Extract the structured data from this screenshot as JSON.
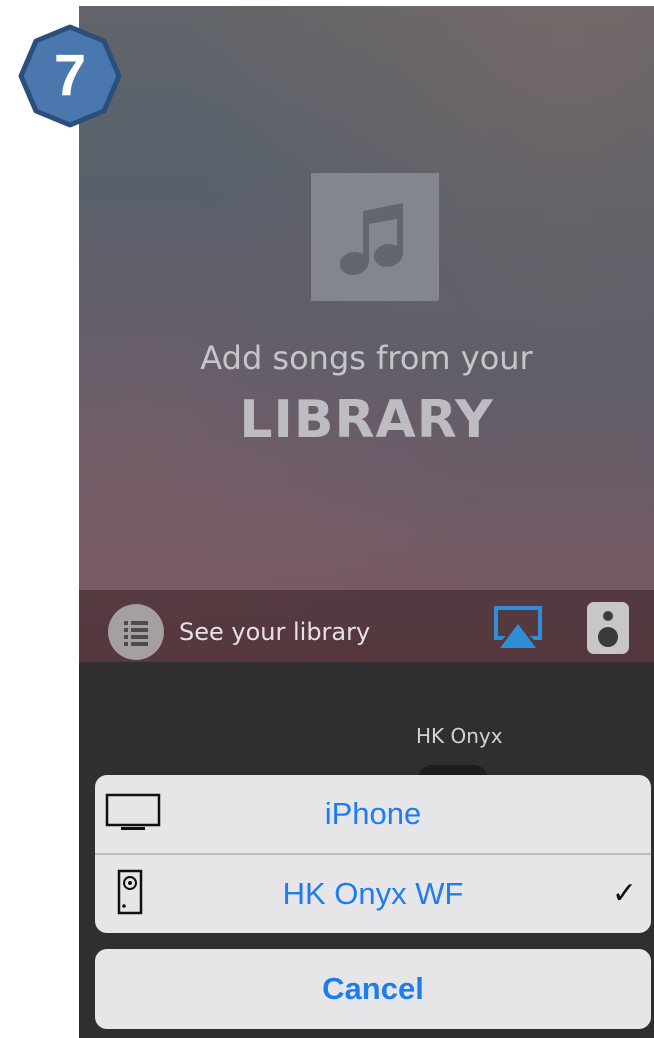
{
  "step_badge": {
    "number": "7"
  },
  "library_empty": {
    "subtitle": "Add songs from your",
    "title": "LIBRARY",
    "icon": "music-note-icon"
  },
  "bottom_bar": {
    "library_button_label": "See your library",
    "library_icon": "list-icon",
    "airplay_icon": "airplay-icon",
    "speaker_icon": "speaker-icon"
  },
  "player": {
    "device_name": "HK Onyx"
  },
  "action_sheet": {
    "options": [
      {
        "label": "iPhone",
        "icon": "tv-icon",
        "selected": false
      },
      {
        "label": "HK Onyx WF",
        "icon": "speaker-icon",
        "selected": true,
        "check": "✓"
      }
    ],
    "cancel_label": "Cancel"
  },
  "colors": {
    "accent_blue": "#1E7CF0",
    "badge_fill": "#4A77AD",
    "badge_border": "#2C4E7C",
    "airplay_blue": "#2F8FD6"
  }
}
